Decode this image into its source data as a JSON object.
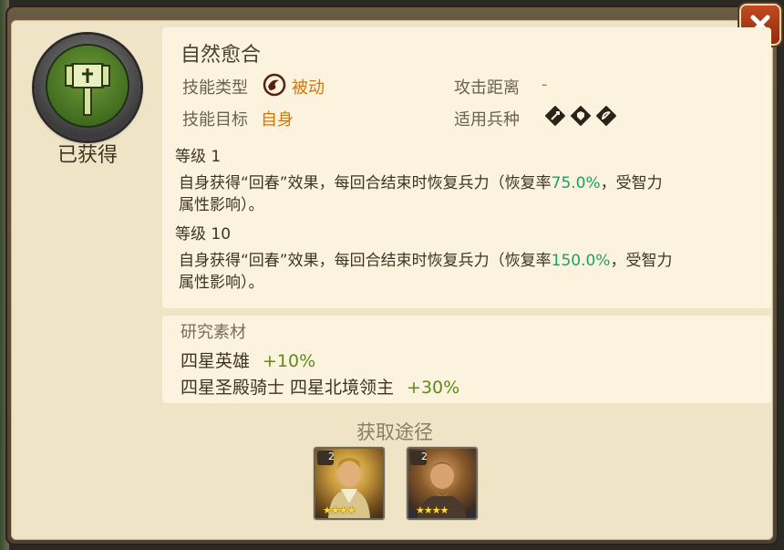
{
  "skill": {
    "name": "自然愈合",
    "status": "已获得",
    "type_label": "技能类型",
    "type_value": "被动",
    "range_label": "攻击距离",
    "range_value": "-",
    "target_label": "技能目标",
    "target_value": "自身",
    "troop_label": "适用兵种",
    "troop_icons": [
      "sword-troop-icon",
      "shield-troop-icon",
      "bow-troop-icon"
    ]
  },
  "levels": [
    {
      "label": "等级 1",
      "desc_pre": "自身获得“回春”效果，每回合结束时恢复兵力（恢复率",
      "rate": "75.0%",
      "desc_post": "，受智力",
      "desc_line2": "属性影响）。"
    },
    {
      "label": "等级 10",
      "desc_pre": "自身获得“回春”效果，每回合结束时恢复兵力（恢复率",
      "rate": "150.0%",
      "desc_post": "，受智力",
      "desc_line2": "属性影响）。"
    }
  ],
  "research": {
    "title": "研究素材",
    "line1_text": "四星英雄",
    "line1_bonus": "+10%",
    "line2_text": "四星圣殿骑士 四星北境领主",
    "line2_bonus": "+30%"
  },
  "acquire": {
    "title": "获取途径",
    "heroes": [
      {
        "badge": "2",
        "stars": "★★★★"
      },
      {
        "badge": "2",
        "stars": "★★★★"
      }
    ]
  },
  "colors": {
    "accent_orange": "#d0760f",
    "rate_green": "#1ea06a",
    "bonus_green": "#5e8b1a",
    "close_red": "#b8401a"
  }
}
